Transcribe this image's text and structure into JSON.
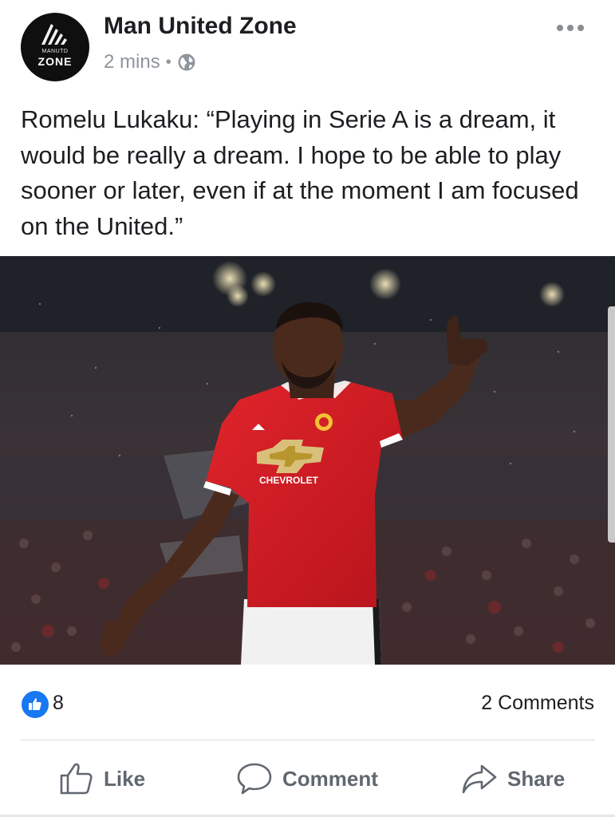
{
  "post": {
    "page_name": "Man United Zone",
    "avatar": {
      "small_text": "MANUTD",
      "big_text": "ZONE"
    },
    "time": "2 mins",
    "separator": "•",
    "privacy_icon": "globe-icon",
    "more_icon": "more-dots-icon",
    "text": "Romelu Lukaku: “Playing in Serie A is a dream, it would be really a dream. I hope to be able to play sooner or later, even if at the moment I am focused on the United.”",
    "photo": {
      "shirt_sponsor": "CHEVROLET"
    }
  },
  "stats": {
    "reaction_icon": "like-reaction-icon",
    "like_count": "8",
    "comments": "2 Comments"
  },
  "actions": {
    "like": "Like",
    "comment": "Comment",
    "share": "Share"
  },
  "colors": {
    "accent": "#1877f2",
    "text": "#1c1e21",
    "muted": "#8f959d",
    "jersey_red": "#d3141d"
  }
}
